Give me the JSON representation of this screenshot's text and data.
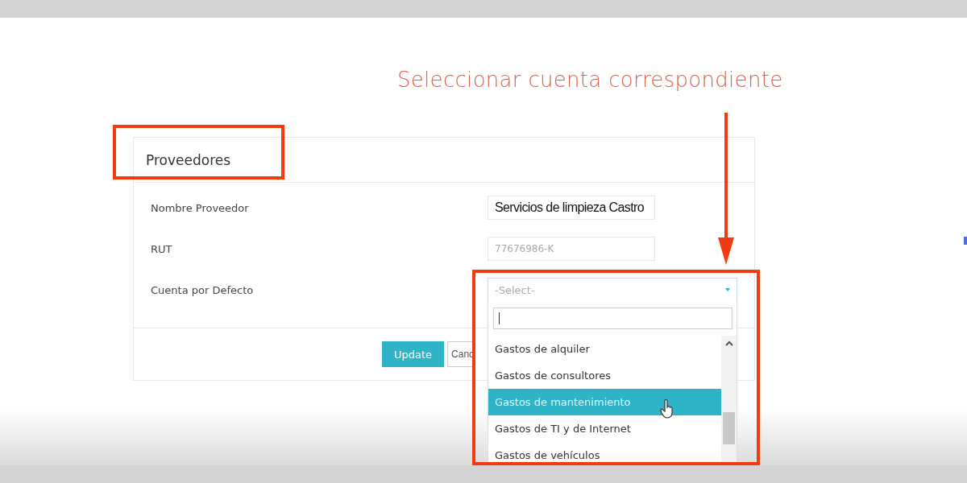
{
  "annotation": {
    "text": "Seleccionar cuenta correspondiente"
  },
  "card": {
    "title": "Proveedores",
    "fields": [
      {
        "kind": "text",
        "label": "Nombre Proveedor",
        "value": "Servicios de limpieza Castro"
      },
      {
        "kind": "readonly",
        "label": "RUT",
        "value": "77676986-K"
      },
      {
        "kind": "select",
        "label": "Cuenta por Defecto",
        "placeholder": "-Select-"
      }
    ],
    "buttons": [
      {
        "kind": "primary",
        "label": "Update"
      },
      {
        "kind": "secondary",
        "label": "Canc"
      }
    ]
  },
  "dropdown": {
    "options": [
      {
        "label": "Gastos de alquiler",
        "selected": false
      },
      {
        "label": "Gastos de consultores",
        "selected": false
      },
      {
        "label": "Gastos de mantenimiento",
        "selected": true
      },
      {
        "label": "Gastos de TI y de Internet",
        "selected": false
      },
      {
        "label": "Gastos de vehículos",
        "selected": false
      }
    ]
  }
}
